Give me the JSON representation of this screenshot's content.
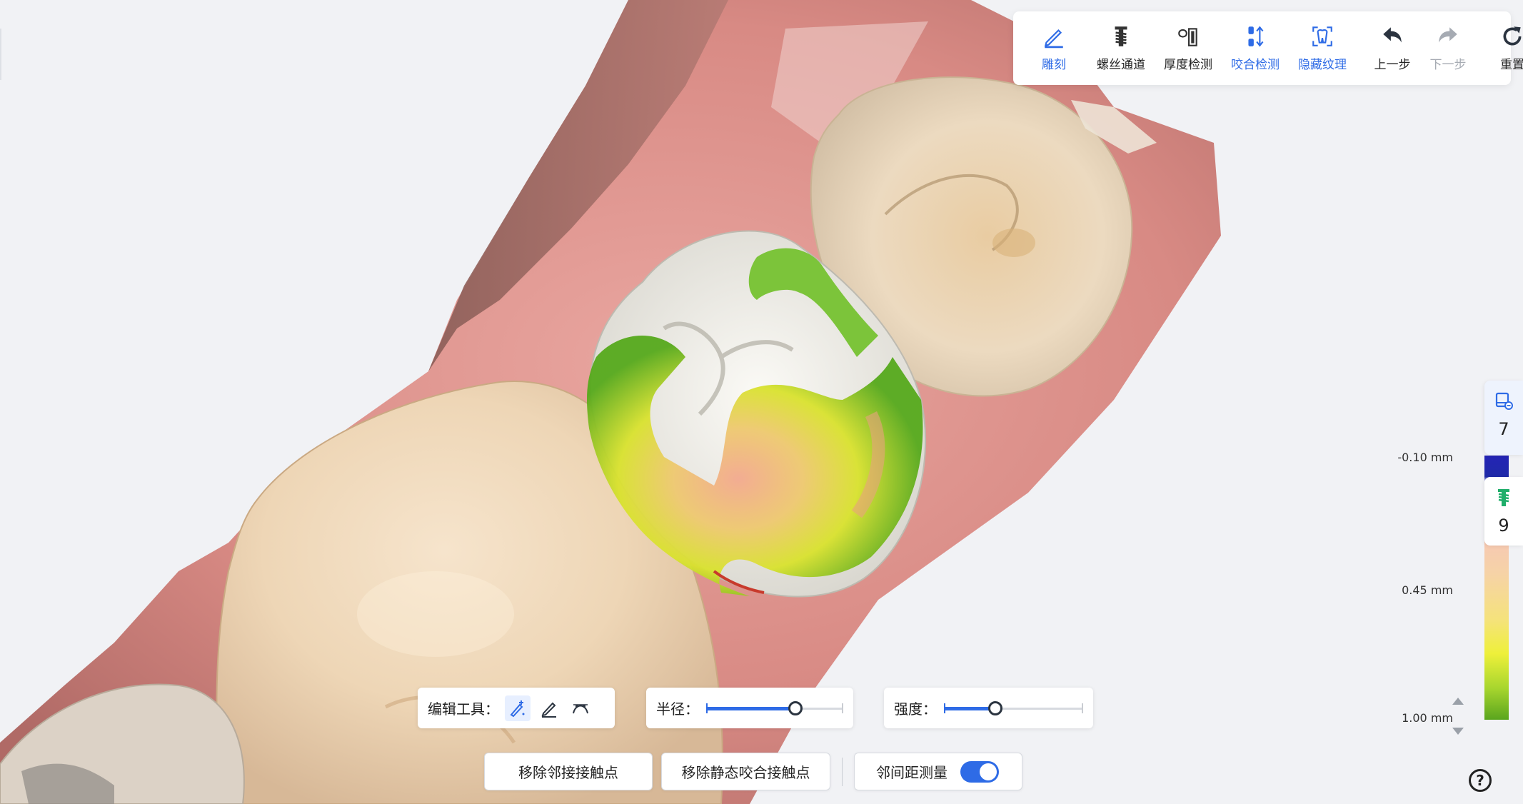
{
  "toolbar": {
    "items": [
      {
        "label": "雕刻",
        "icon": "sculpt-pen-icon",
        "state": "active"
      },
      {
        "label": "螺丝通道",
        "icon": "screw-channel-icon",
        "state": "normal"
      },
      {
        "label": "厚度检测",
        "icon": "thickness-check-icon",
        "state": "normal"
      },
      {
        "label": "咬合检测",
        "icon": "occlusion-check-icon",
        "state": "active"
      },
      {
        "label": "隐藏纹理",
        "icon": "hide-texture-icon",
        "state": "active"
      },
      {
        "label": "上一步",
        "icon": "undo-icon",
        "state": "normal"
      },
      {
        "label": "下一步",
        "icon": "redo-icon",
        "state": "disabled"
      },
      {
        "label": "重置",
        "icon": "reset-icon",
        "state": "normal"
      }
    ]
  },
  "side_tabs": [
    {
      "icon": "model-layer-icon",
      "count": "7"
    },
    {
      "icon": "implant-screw-icon",
      "count": "9"
    }
  ],
  "scale": {
    "top_label": "-0.10 mm",
    "mid_label": "0.45 mm",
    "bottom_label": "1.00 mm"
  },
  "edit_tools": {
    "label": "编辑工具：",
    "tools": [
      {
        "icon": "brush-add-icon",
        "active": true
      },
      {
        "icon": "pen-icon",
        "active": false
      },
      {
        "icon": "curve-smooth-icon",
        "active": false
      }
    ]
  },
  "radius": {
    "label": "半径：",
    "value_fraction": 0.65
  },
  "strength": {
    "label": "强度：",
    "value_fraction": 0.37
  },
  "buttons": {
    "remove_proximal": "移除邻接接触点",
    "remove_static": "移除静态咬合接触点",
    "distance_measure": "邻间距测量",
    "distance_measure_on": true
  },
  "help": {
    "symbol": "?"
  },
  "colors": {
    "accent": "#2e6be6",
    "gum": "#d98f88",
    "crown": "#efeee8"
  }
}
